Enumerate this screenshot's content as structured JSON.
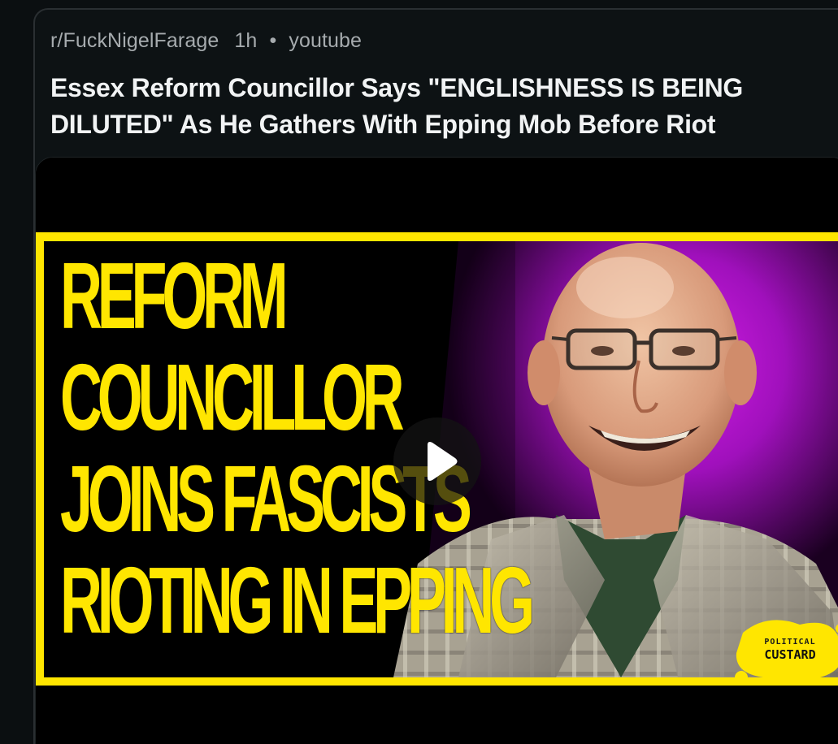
{
  "post": {
    "subreddit": "r/FuckNigelFarage",
    "time": "1h",
    "separator": "•",
    "source": "youtube",
    "title": "Essex Reform Councillor Says \"ENGLISHNESS IS BEING DILUTED\" As He Gathers With Epping Mob Before Riot"
  },
  "thumbnail": {
    "headline_lines": [
      "REFORM",
      "COUNCILLOR",
      "JOINS FASCISTS",
      "RIOTING IN EPPING"
    ],
    "badge_line1": "POLITICAL",
    "badge_line2": "CUSTARD",
    "play_icon": "play-icon",
    "colors": {
      "accent_yellow": "#ffe600",
      "background_purple": "#b011c8",
      "background_black": "#000000"
    }
  }
}
